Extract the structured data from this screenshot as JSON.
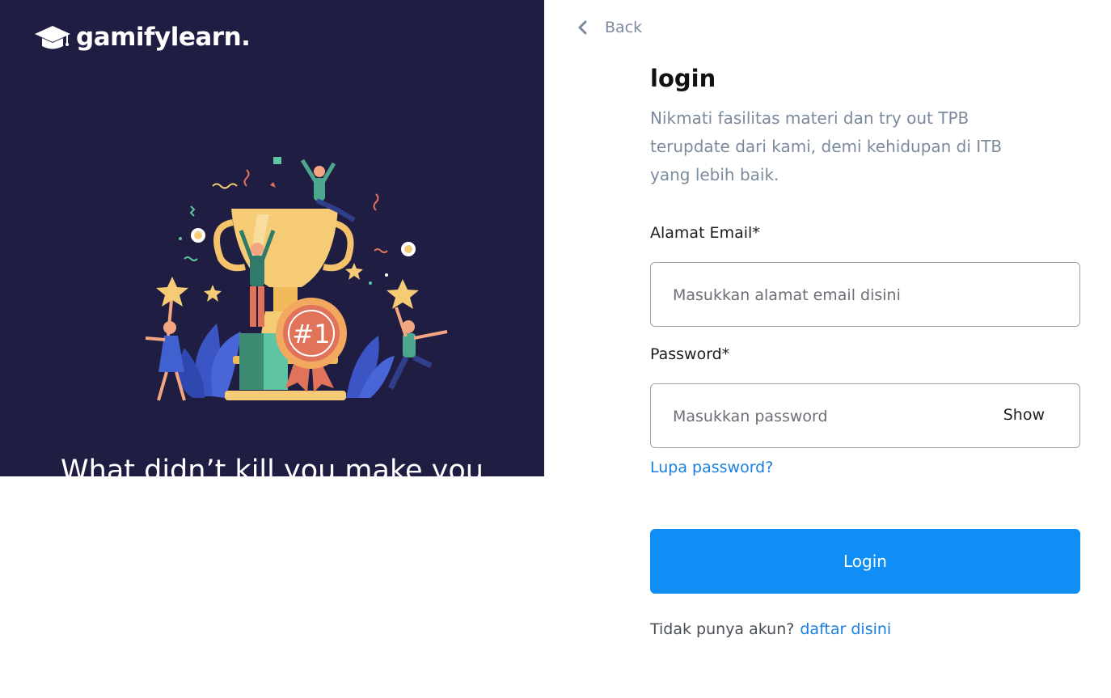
{
  "brand": {
    "name": "gamifylearn."
  },
  "left_panel": {
    "tagline": "What didn’t kill you make you",
    "badge_text": "#1",
    "background": "#1f1d42"
  },
  "back": {
    "label": "Back",
    "icon": "chevron-left-icon"
  },
  "login": {
    "title": "login",
    "subtitle": "Nikmati fasilitas materi dan try out TPB terupdate dari kami, demi kehidupan di ITB yang lebih baik.",
    "email": {
      "label": "Alamat Email*",
      "placeholder": "Masukkan alamat email disini",
      "value": ""
    },
    "password": {
      "label": "Password*",
      "placeholder": "Masukkan password",
      "value": "",
      "toggle_label": "Show"
    },
    "forgot_label": "Lupa password?",
    "submit_label": "Login",
    "signup_prompt": "Tidak punya akun?",
    "signup_link": "daftar disini"
  },
  "colors": {
    "primary": "#0f8ff5",
    "link": "#1a7fe0",
    "muted_text": "#7c8a9e",
    "dark_panel": "#1f1d42"
  }
}
